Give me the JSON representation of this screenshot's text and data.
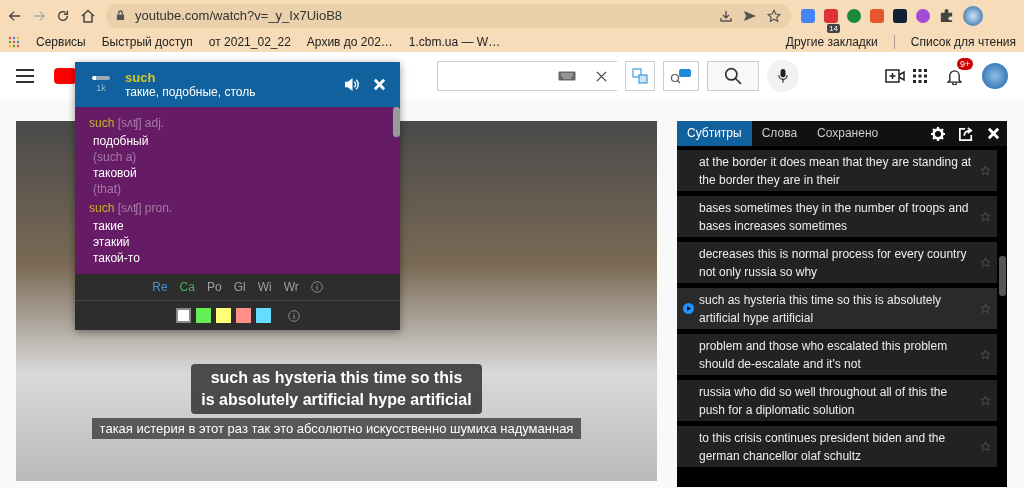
{
  "browser": {
    "url": "youtube.com/watch?v=_y_Ix7UioB8",
    "extension_badge": "14",
    "bookmarks": [
      "Сервисы",
      "Быстрый доступ",
      "от 2021_02_22",
      "Архив до 202…",
      "1.cbm.ua — W…"
    ],
    "other_bookmarks": "Другие закладки",
    "reading_list": "Список для чтения"
  },
  "header": {
    "notification_badge": "9+"
  },
  "popup": {
    "word": "such",
    "frequency": "1k",
    "translation": "такие, подобные, столь",
    "entries": [
      {
        "word": "such",
        "transcription": "[sʌʧ]",
        "pos": "adj.",
        "senses": [
          {
            "text": "подобный",
            "kind": "translation"
          },
          {
            "text": "(such a)",
            "kind": "note"
          },
          {
            "text": "таковой",
            "kind": "translation"
          },
          {
            "text": "(that)",
            "kind": "note"
          }
        ]
      },
      {
        "word": "such",
        "transcription": "[sʌʧ]",
        "pos": "pron.",
        "senses": [
          {
            "text": "такие",
            "kind": "translation"
          },
          {
            "text": "этакий",
            "kind": "translation"
          },
          {
            "text": "такой-то",
            "kind": "translation"
          }
        ]
      }
    ],
    "sources": [
      {
        "label": "Re",
        "color": "#4a8fd0"
      },
      {
        "label": "Ca",
        "color": "#4caf50"
      },
      {
        "label": "Po",
        "color": "#9e9e9e"
      },
      {
        "label": "Gl",
        "color": "#9e9e9e"
      },
      {
        "label": "Wi",
        "color": "#9e9e9e"
      },
      {
        "label": "Wr",
        "color": "#9e9e9e"
      }
    ],
    "swatches": [
      {
        "color": "#ffffff",
        "selected": true
      },
      {
        "color": "#66ee55",
        "selected": false
      },
      {
        "color": "#ffff77",
        "selected": false
      },
      {
        "color": "#ff8f88",
        "selected": false
      },
      {
        "color": "#66ddff",
        "selected": false
      }
    ]
  },
  "captions": {
    "original": [
      "such as hysteria this time so this",
      "is absolutely artificial hype artificial"
    ],
    "translation": "такая истерия в этот раз так это абсолютно искусственно шумиха надуманная"
  },
  "panel": {
    "tabs": [
      {
        "label": "Субтитры",
        "selected": true
      },
      {
        "label": "Слова",
        "selected": false
      },
      {
        "label": "Сохранено",
        "selected": false
      }
    ],
    "rows": [
      {
        "text": "at the border it does mean that they are standing at the border they are in their",
        "selected": false
      },
      {
        "text": "bases sometimes they in the number of troops and bases increases sometimes",
        "selected": false
      },
      {
        "text": "decreases this is normal process for every country not only russia so why",
        "selected": false
      },
      {
        "text": "such as hysteria this time so this is absolutely artificial hype artificial",
        "selected": true
      },
      {
        "text": "problem and those who escalated this problem should de-escalate and it's not",
        "selected": false
      },
      {
        "text": "russia who did so well throughout all of this the push for a diplomatic solution",
        "selected": false
      },
      {
        "text": "to this crisis continues president biden and the german chancellor olaf schultz",
        "selected": false
      }
    ]
  }
}
